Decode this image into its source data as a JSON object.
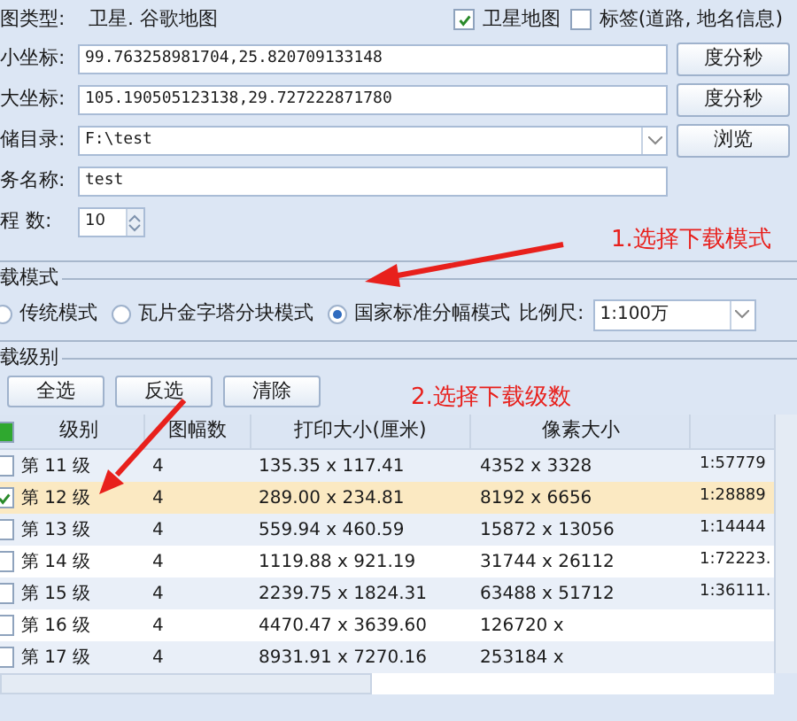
{
  "form": {
    "map_type_label": "图类型:",
    "map_type_value": "卫星. 谷歌地图",
    "layers": [
      {
        "label": "卫星地图",
        "checked": true
      },
      {
        "label": "标签(道路, 地名信息)",
        "checked": false
      }
    ],
    "fields": [
      {
        "label": "小坐标:",
        "value": "99.763258981704,25.820709133148",
        "button": "度分秒",
        "kind": "text"
      },
      {
        "label": "大坐标:",
        "value": "105.190505123138,29.727222871780",
        "button": "度分秒",
        "kind": "text"
      },
      {
        "label": "储目录:",
        "value": "F:\\test",
        "button": "浏览",
        "kind": "dropdown"
      },
      {
        "label": "务名称:",
        "value": "test",
        "kind": "text"
      }
    ],
    "threads_label": "程 数:",
    "threads_value": "10"
  },
  "mode_group": {
    "title": "载模式",
    "options": [
      {
        "label": "传统模式",
        "selected": false
      },
      {
        "label": "瓦片金字塔分块模式",
        "selected": false
      },
      {
        "label": "国家标准分幅模式",
        "selected": true
      }
    ],
    "scale_label": "比例尺:",
    "scale_value": "1:100万"
  },
  "level_group": {
    "title": "载级别",
    "buttons": [
      "全选",
      "反选",
      "清除"
    ]
  },
  "table": {
    "header_checked": true,
    "columns": [
      "级别",
      "图幅数",
      "打印大小(厘米)",
      "像素大小"
    ],
    "rows": [
      {
        "cells": [
          "第 11 级",
          "4",
          "135.35 x 117.41",
          "4352 x 3328",
          "1:57779"
        ],
        "checked": false,
        "selected": false
      },
      {
        "cells": [
          "第 12 级",
          "4",
          "289.00 x 234.81",
          "8192 x 6656",
          "1:28889"
        ],
        "checked": true,
        "selected": true
      },
      {
        "cells": [
          "第 13 级",
          "4",
          "559.94 x 460.59",
          "15872 x 13056",
          "1:14444"
        ],
        "checked": false,
        "selected": false
      },
      {
        "cells": [
          "第 14 级",
          "4",
          "1119.88 x 921.19",
          "31744 x 26112",
          "1:72223."
        ],
        "checked": false,
        "selected": false
      },
      {
        "cells": [
          "第 15 级",
          "4",
          "2239.75 x 1824.31",
          "63488 x 51712",
          "1:36111."
        ],
        "checked": false,
        "selected": false
      },
      {
        "cells": [
          "第 16 级",
          "4",
          "4470.47 x 3639.60",
          "126720 x"
        ],
        "checked": false,
        "selected": false
      },
      {
        "cells": [
          "第 17 级",
          "4",
          "8931.91 x 7270.16",
          "253184 x"
        ],
        "checked": false,
        "selected": false
      }
    ]
  },
  "annotations": [
    {
      "text": "1.选择下载模式"
    },
    {
      "text": "2.选择下载级数"
    }
  ]
}
